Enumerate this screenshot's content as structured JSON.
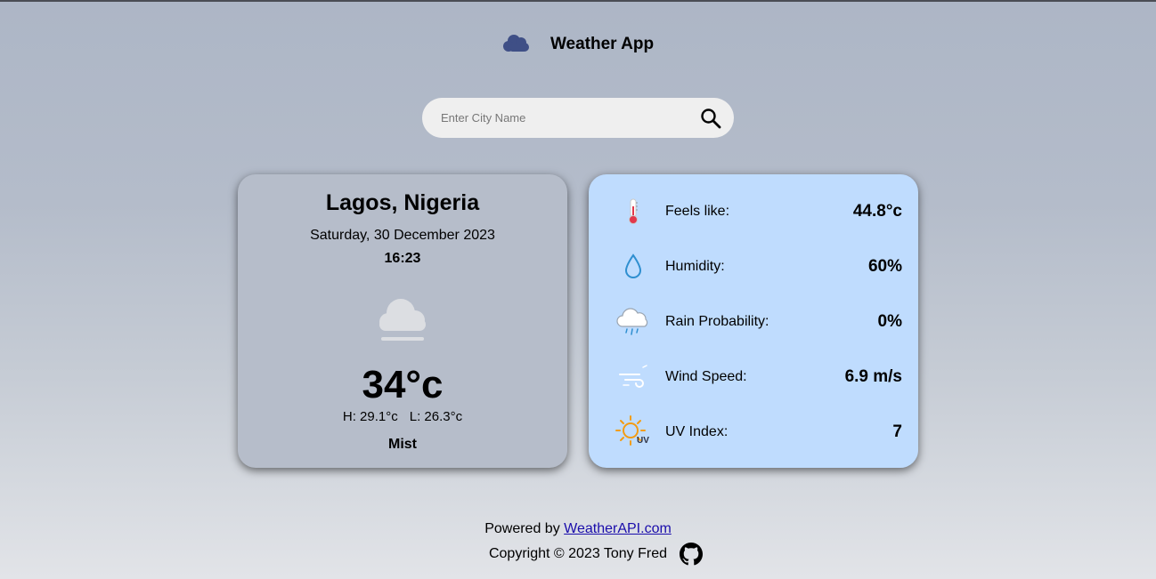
{
  "header": {
    "title": "Weather App",
    "logo_icon": "cloud-icon"
  },
  "search": {
    "placeholder": "Enter City Name",
    "value": "",
    "icon": "search-icon"
  },
  "current": {
    "city": "Lagos, Nigeria",
    "date": "Saturday, 30 December 2023",
    "time": "16:23",
    "icon": "mist-cloud-icon",
    "temp": "34°c",
    "high": "H: 29.1°c",
    "low": "L: 26.3°c",
    "condition": "Mist"
  },
  "details": [
    {
      "label": "Feels like:",
      "value": "44.8°c",
      "icon": "thermometer-icon"
    },
    {
      "label": "Humidity:",
      "value": "60%",
      "icon": "water-drop-icon"
    },
    {
      "label": "Rain Probability:",
      "value": "0%",
      "icon": "rain-cloud-icon"
    },
    {
      "label": "Wind Speed:",
      "value": "6.9 m/s",
      "icon": "wind-icon"
    },
    {
      "label": "UV Index:",
      "value": "7",
      "icon": "uv-sun-icon"
    }
  ],
  "footer": {
    "powered_prefix": "Powered by",
    "powered_link": "WeatherAPI.com",
    "copyright": "Copyright © 2023 Tony Fred",
    "github_icon": "github-icon"
  },
  "colors": {
    "left_card": "#b6bdca",
    "right_card": "#bfdcfe",
    "logo": "#3f4f86",
    "link": "#1a0dab"
  }
}
